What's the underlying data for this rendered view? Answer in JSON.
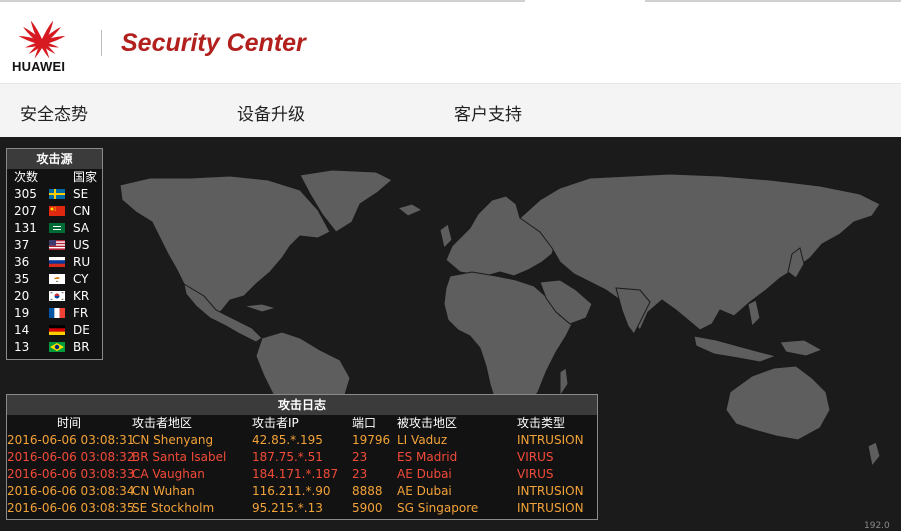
{
  "header": {
    "brand": "HUAWEI",
    "app_title": "Security Center"
  },
  "nav": {
    "items": [
      "安全态势",
      "设备升级",
      "客户支持"
    ]
  },
  "attack_source": {
    "title": "攻击源",
    "col_count": "次数",
    "col_country": "国家",
    "rows": [
      {
        "count": "305",
        "country": "SE",
        "flag": "se-flag-icon"
      },
      {
        "count": "207",
        "country": "CN",
        "flag": "cn-flag-icon"
      },
      {
        "count": "131",
        "country": "SA",
        "flag": "sa-flag-icon"
      },
      {
        "count": "37",
        "country": "US",
        "flag": "us-flag-icon"
      },
      {
        "count": "36",
        "country": "RU",
        "flag": "ru-flag-icon"
      },
      {
        "count": "35",
        "country": "CY",
        "flag": "cy-flag-icon"
      },
      {
        "count": "20",
        "country": "KR",
        "flag": "kr-flag-icon"
      },
      {
        "count": "19",
        "country": "FR",
        "flag": "fr-flag-icon"
      },
      {
        "count": "14",
        "country": "DE",
        "flag": "de-flag-icon"
      },
      {
        "count": "13",
        "country": "BR",
        "flag": "br-flag-icon"
      }
    ]
  },
  "attack_log": {
    "title": "攻击日志",
    "headers": [
      "时间",
      "攻击者地区",
      "攻击者IP",
      "端口",
      "被攻击地区",
      "攻击类型"
    ],
    "rows": [
      {
        "time": "2016-06-06 03:08:31",
        "attacker_region": "CN Shenyang",
        "ip": "42.85.*.195",
        "port": "19796",
        "target_region": "LI Vaduz",
        "type": "INTRUSION",
        "color": "#f3a338"
      },
      {
        "time": "2016-06-06 03:08:32",
        "attacker_region": "BR Santa Isabel",
        "ip": "187.75.*.51",
        "port": "23",
        "target_region": "ES Madrid",
        "type": "VIRUS",
        "color": "#f24b38"
      },
      {
        "time": "2016-06-06 03:08:33",
        "attacker_region": "CA Vaughan",
        "ip": "184.171.*.187",
        "port": "23",
        "target_region": "AE Dubai",
        "type": "VIRUS",
        "color": "#f24b38"
      },
      {
        "time": "2016-06-06 03:08:34",
        "attacker_region": "CN Wuhan",
        "ip": "116.211.*.90",
        "port": "8888",
        "target_region": "AE Dubai",
        "type": "INTRUSION",
        "color": "#f3a338"
      },
      {
        "time": "2016-06-06 03:08:35",
        "attacker_region": "SE Stockholm",
        "ip": "95.215.*.13",
        "port": "5900",
        "target_region": "SG Singapore",
        "type": "INTRUSION",
        "color": "#f3a338"
      }
    ]
  },
  "corner_text": "192.0",
  "colors": {
    "brand_red": "#b2201e",
    "intrusion": "#f3a338",
    "virus": "#f24b38",
    "land": "#5e5e5e",
    "background": "#1b1b1b"
  }
}
